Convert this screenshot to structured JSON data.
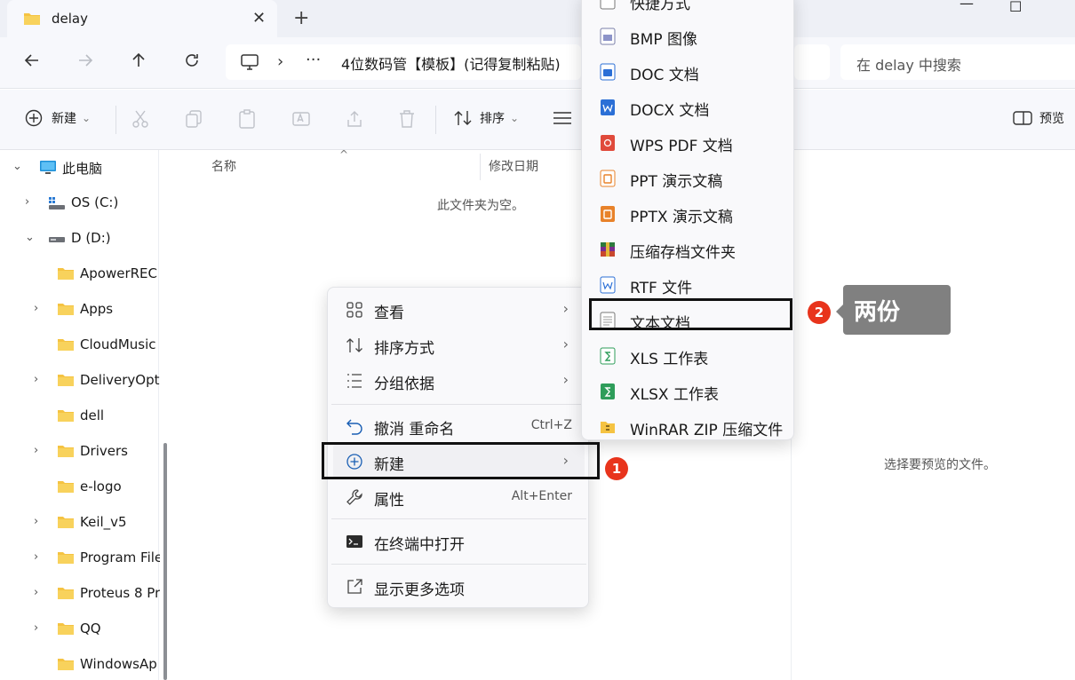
{
  "tab": {
    "title": "delay",
    "close": "✕",
    "new_tab": "+"
  },
  "window": {
    "minimize": "—",
    "maximize": "☐"
  },
  "address": {
    "separator": "›",
    "overflow": "···",
    "path": "4位数码管【模板】(记得复制粘贴)",
    "search_placeholder": "在 delay 中搜索"
  },
  "toolbar": {
    "new_label": "新建",
    "sort_label": "排序",
    "preview_label": "预览",
    "chevron": "⌄"
  },
  "sidebar": {
    "items": [
      {
        "label": "此电脑",
        "chevron": "⌄"
      },
      {
        "label": "OS (C:)",
        "chevron": "›"
      },
      {
        "label": "D (D:)",
        "chevron": "⌄"
      },
      {
        "label": "ApowerREC",
        "chevron": ""
      },
      {
        "label": "Apps",
        "chevron": "›"
      },
      {
        "label": "CloudMusic",
        "chevron": ""
      },
      {
        "label": "DeliveryOpt",
        "chevron": "›"
      },
      {
        "label": "dell",
        "chevron": ""
      },
      {
        "label": "Drivers",
        "chevron": "›"
      },
      {
        "label": "e-logo",
        "chevron": ""
      },
      {
        "label": "Keil_v5",
        "chevron": "›"
      },
      {
        "label": "Program File",
        "chevron": "›"
      },
      {
        "label": "Proteus 8 Pr",
        "chevron": "›"
      },
      {
        "label": "QQ",
        "chevron": "›"
      },
      {
        "label": "WindowsAp",
        "chevron": ""
      }
    ]
  },
  "main": {
    "col_name": "名称",
    "col_sort_caret": "^",
    "col_modified": "修改日期",
    "empty_message": "此文件夹为空。",
    "preview_message": "选择要预览的文件。"
  },
  "context_menu": {
    "items": [
      {
        "label": "查看",
        "arrow": "›",
        "shortcut": ""
      },
      {
        "label": "排序方式",
        "arrow": "›",
        "shortcut": ""
      },
      {
        "label": "分组依据",
        "arrow": "›",
        "shortcut": ""
      },
      {
        "label": "撤消 重命名",
        "arrow": "",
        "shortcut": "Ctrl+Z"
      },
      {
        "label": "新建",
        "arrow": "›",
        "shortcut": ""
      },
      {
        "label": "属性",
        "arrow": "",
        "shortcut": "Alt+Enter"
      },
      {
        "label": "在终端中打开",
        "arrow": "",
        "shortcut": ""
      },
      {
        "label": "显示更多选项",
        "arrow": "",
        "shortcut": ""
      }
    ]
  },
  "submenu": {
    "items": [
      {
        "label": "快捷方式"
      },
      {
        "label": "BMP 图像"
      },
      {
        "label": "DOC 文档"
      },
      {
        "label": "DOCX 文档"
      },
      {
        "label": "WPS PDF 文档"
      },
      {
        "label": "PPT 演示文稿"
      },
      {
        "label": "PPTX 演示文稿"
      },
      {
        "label": "压缩存档文件夹"
      },
      {
        "label": "RTF 文件"
      },
      {
        "label": "文本文档"
      },
      {
        "label": "XLS 工作表"
      },
      {
        "label": "XLSX 工作表"
      },
      {
        "label": "WinRAR ZIP 压缩文件"
      }
    ]
  },
  "annotations": {
    "badge1": "1",
    "badge2": "2",
    "callout": "两份"
  },
  "colors": {
    "folder_yellow": "#f5c342",
    "annotation_red": "#e8341c",
    "callout_gray": "#808080"
  }
}
